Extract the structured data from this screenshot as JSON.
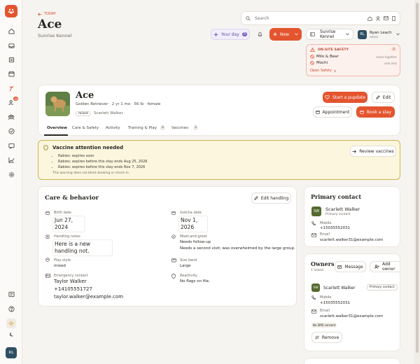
{
  "header": {
    "back_label": "TODAY",
    "title": "Ace",
    "subtitle": "Sunrise Kennel"
  },
  "topbar": {
    "search_placeholder": "Search",
    "your_day_label": "Your day",
    "your_day_count": "0",
    "new_label": "New",
    "location_label": "Sunrise Kennel",
    "user_initials": "RL",
    "user_name": "Ryan Leach",
    "user_role": "owner"
  },
  "safety": {
    "title": "ON-SITE SAFETY",
    "count": "2",
    "items": [
      {
        "name": "Milo & Bear",
        "note": "never together"
      },
      {
        "name": "Mochi",
        "note": "solo only"
      }
    ],
    "link": "Open Safety"
  },
  "profile": {
    "name": "Ace",
    "details": "Golden Retriever · 2 yr 1 mo · 56 lb · female",
    "tag": "mixed",
    "owner": "Scarlett Walker",
    "start_pupdate": "Start a pupdate",
    "edit": "Edit",
    "appointment": "Appointment",
    "book_stay": "Book a stay"
  },
  "tabs": [
    {
      "label": "Overview",
      "count": ""
    },
    {
      "label": "Care & Safety",
      "count": ""
    },
    {
      "label": "Activity",
      "count": ""
    },
    {
      "label": "Training & Play",
      "count": "0"
    },
    {
      "label": "Vaccines",
      "count": "3"
    }
  ],
  "vaccine_alert": {
    "title": "Vaccine attention needed",
    "items": [
      "Rabies: expires soon",
      "Rabies: expires before this stay ends Aug 25, 2026",
      "Rabies: expires before this stay ends Nov 7, 2026"
    ],
    "note": "This warning does not block booking or check-in.",
    "review_label": "Review vaccines"
  },
  "care": {
    "title": "Care & behavior",
    "edit_label": "Edit handling",
    "fields": {
      "birth_date_label": "Birth date",
      "birth_date": "Jun 27, 2024",
      "gotcha_label": "Gotcha date",
      "gotcha": "Nov 1, 2026",
      "handling_label": "Handling notes",
      "handling": "Here is a new handling not.",
      "meet_label": "Meet-and-greet",
      "meet_1": "Needs follow-up",
      "meet_2": "Needs a second visit; was overwhelmed by the large group.",
      "play_label": "Play style",
      "play": "mixed",
      "size_label": "Size band",
      "size": "Large",
      "emergency_label": "Emergency contact",
      "emergency_name": "Taylor Walker",
      "emergency_phone": "+14105551727",
      "emergency_email": "taylor.walker@example.com",
      "reactivity_label": "Reactivity",
      "reactivity": "No flags on file."
    }
  },
  "primary_contact": {
    "title": "Primary contact",
    "initials": "SW",
    "name": "Scarlett Walker",
    "role": "Primary contact",
    "mobile_label": "Mobile",
    "mobile": "+15035552031",
    "email_label": "Email",
    "email": "scarlett.walker31@example.com"
  },
  "owners": {
    "title": "Owners",
    "count": "1 linked",
    "message_label": "Message",
    "add_label": "Add owner",
    "initials": "SW",
    "name": "Scarlett Walker",
    "badge": "Primary contact",
    "mobile_label": "Mobile",
    "mobile": "+15035552031",
    "email_label": "Email",
    "email": "scarlett.walker31@example.com",
    "sms": "No SMS consent",
    "remove_label": "Remove"
  },
  "sidebar_user": "RL",
  "colors": {
    "accent": "#e3552f",
    "alert_bg": "#fbf6dd",
    "alert_border": "#c9b54a",
    "safety_bg": "#fdf1ee"
  }
}
